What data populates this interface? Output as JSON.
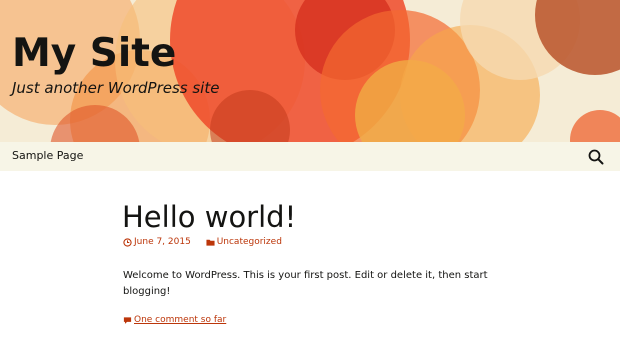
{
  "site": {
    "title": "My Site",
    "description": "Just another WordPress site"
  },
  "nav": {
    "items": [
      {
        "label": "Sample Page"
      }
    ],
    "search_icon": "search-icon"
  },
  "post": {
    "title": "Hello world!",
    "date": "June 7, 2015",
    "category": "Uncategorized",
    "excerpt": "Welcome to WordPress. This is your first post. Edit or delete it, then start blogging!",
    "comments": "One comment so far"
  },
  "colors": {
    "link": "#bc360a",
    "nav_bg": "#f7f5e7",
    "text": "#141412"
  }
}
